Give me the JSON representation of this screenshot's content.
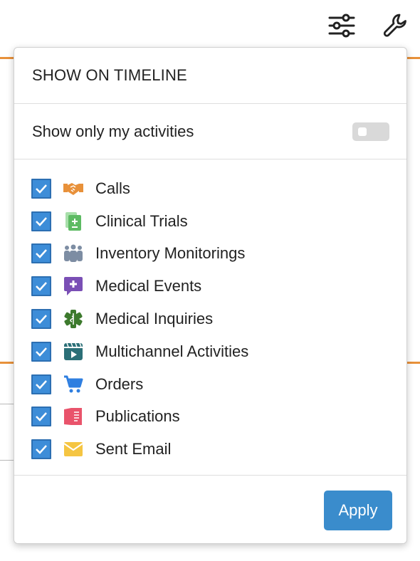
{
  "toolbar": {
    "filter_icon": "sliders-icon",
    "settings_icon": "wrench-icon"
  },
  "popover": {
    "title": "SHOW ON TIMELINE",
    "toggle": {
      "label": "Show only my activities",
      "on": false
    },
    "items": [
      {
        "label": "Calls",
        "checked": true,
        "icon": "handshake-icon",
        "color": "#e8913a"
      },
      {
        "label": "Clinical Trials",
        "checked": true,
        "icon": "clipboard-plus-icon",
        "color": "#5dbb63"
      },
      {
        "label": "Inventory Monitorings",
        "checked": true,
        "icon": "people-group-icon",
        "color": "#7d8da3"
      },
      {
        "label": "Medical Events",
        "checked": true,
        "icon": "medical-chat-icon",
        "color": "#7a4fb5"
      },
      {
        "label": "Medical Inquiries",
        "checked": true,
        "icon": "star-of-life-icon",
        "color": "#3d7a2d"
      },
      {
        "label": "Multichannel Activities",
        "checked": true,
        "icon": "video-clapper-icon",
        "color": "#2b6f77"
      },
      {
        "label": "Orders",
        "checked": true,
        "icon": "cart-icon",
        "color": "#2f7fe0"
      },
      {
        "label": "Publications",
        "checked": true,
        "icon": "book-icon",
        "color": "#e9536b"
      },
      {
        "label": "Sent Email",
        "checked": true,
        "icon": "envelope-icon",
        "color": "#f5c542"
      }
    ],
    "apply_label": "Apply"
  },
  "colors": {
    "accent": "#3a8ccc",
    "checkbox": "#3d8dd8",
    "background_line": "#e8913a"
  }
}
